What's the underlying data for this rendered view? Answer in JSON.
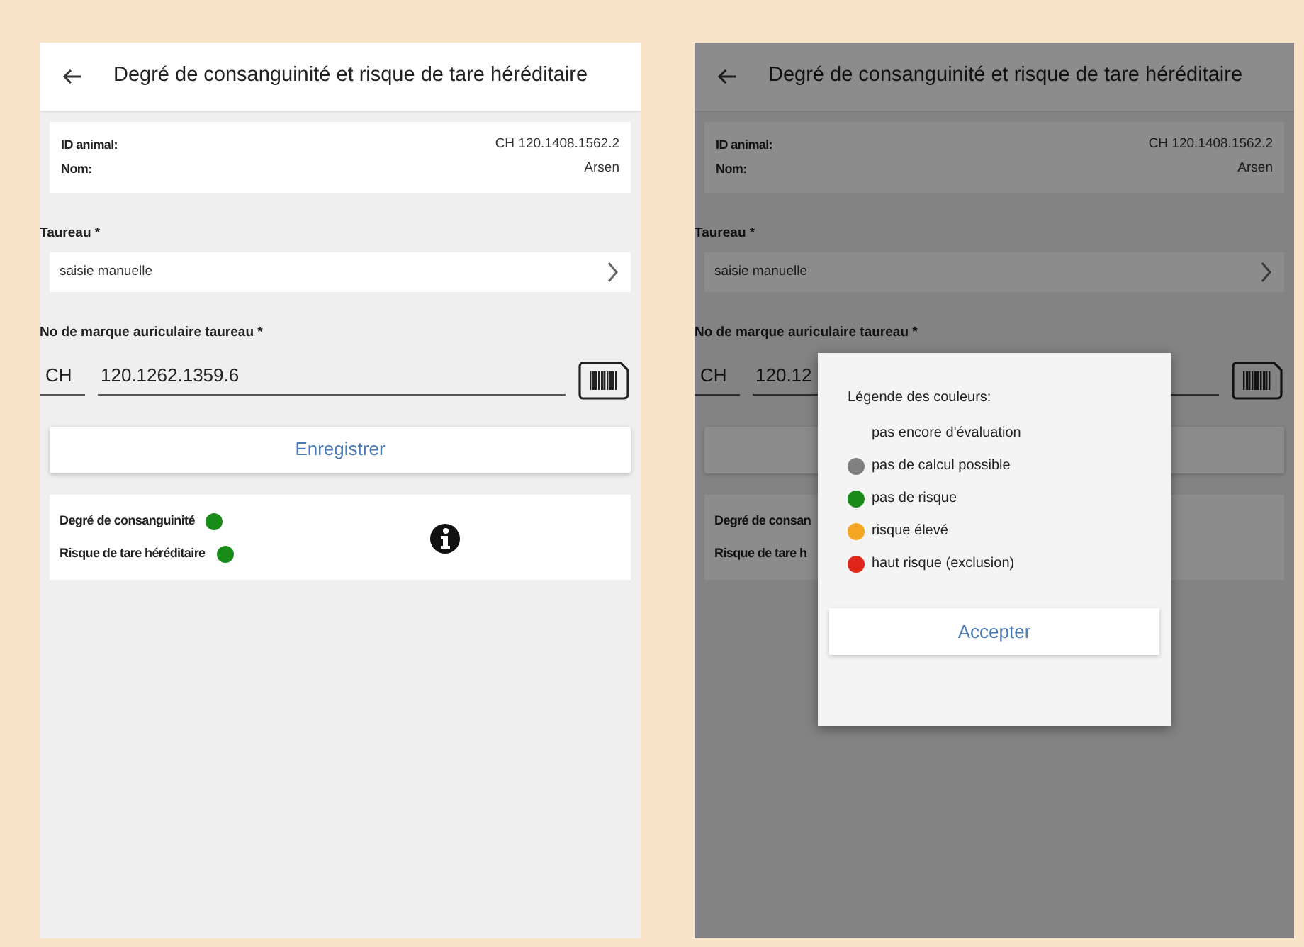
{
  "screens": [
    {
      "title": "Degré de consanguinité et risque de tare héréditaire",
      "animal": [
        {
          "label": "ID animal:",
          "value": "CH 120.1408.1562.2"
        },
        {
          "label": "Nom:",
          "value": "Arsen"
        }
      ],
      "bull_label": "Taureau *",
      "bull_value": "saisie manuelle",
      "ear_tag_label": "No de marque auriculaire taureau *",
      "country": "CH",
      "ear_tag": "120.1262.1359.6",
      "save_button": "Enregistrer",
      "results": [
        {
          "label": "Degré de consanguinité",
          "color": "#1a8c1a"
        },
        {
          "label": "Risque de tare héréditaire",
          "color": "#1a8c1a"
        }
      ]
    },
    {
      "title": "Degré de consanguinité et risque de tare héréditaire",
      "animal": [
        {
          "label": "ID animal:",
          "value": "CH 120.1408.1562.2"
        },
        {
          "label": "Nom:",
          "value": "Arsen"
        }
      ],
      "bull_label": "Taureau *",
      "bull_value": "saisie manuelle",
      "ear_tag_label": "No de marque auriculaire taureau *",
      "country": "CH",
      "ear_tag": "120.12",
      "results": [
        {
          "label": "Degré de consan"
        },
        {
          "label": "Risque de tare h"
        }
      ],
      "dialog": {
        "title": "Légende des couleurs:",
        "items": [
          {
            "label": "pas encore d'évaluation"
          },
          {
            "label": "pas de calcul possible",
            "color": "#808080"
          },
          {
            "label": "pas de risque",
            "color": "#1a8c1a"
          },
          {
            "label": "risque élevé",
            "color": "#f5a623"
          },
          {
            "label": "haut risque (exclusion)",
            "color": "#e0261a"
          }
        ],
        "button": "Accepter"
      }
    }
  ]
}
